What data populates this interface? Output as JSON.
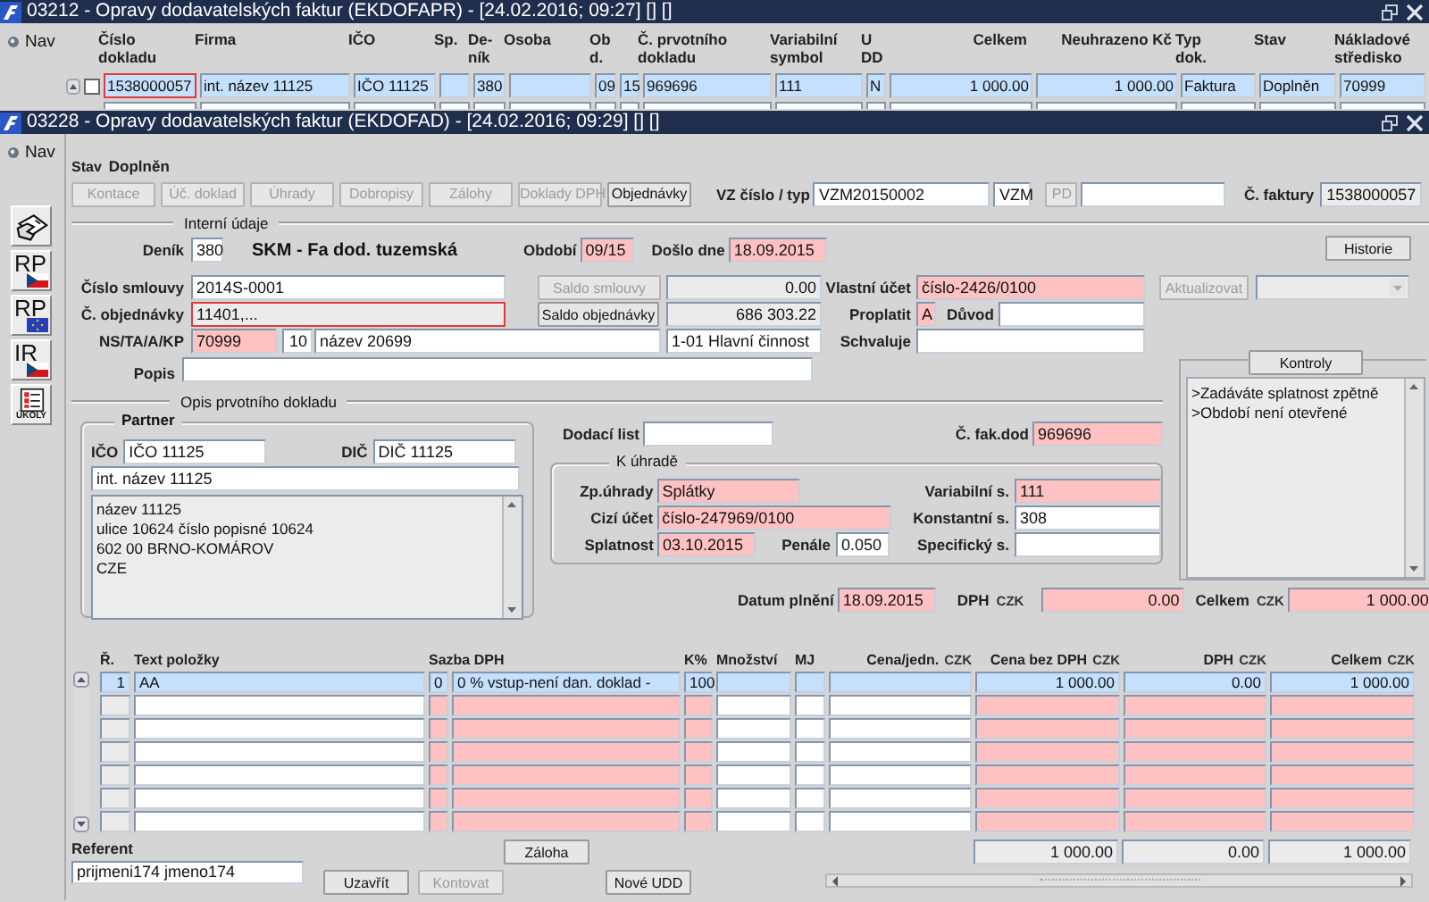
{
  "list_window": {
    "title": "03212 - Opravy dodavatelských faktur (EKDOFAPR) - [24.02.2016; 09:27] [] []",
    "nav": "Nav",
    "columns": [
      "Číslo\ndokladu",
      "Firma",
      "IČO",
      "Sp.",
      "De-\nník",
      "Osoba",
      "Ob\nd.",
      "Č. prvotního\ndokladu",
      "Variabilní\nsymbol",
      "U\nDD",
      "Celkem",
      "Neuhrazeno Kč",
      "Typ\ndok.",
      "Stav",
      "Nákladové\nstředisko"
    ],
    "rows": [
      {
        "selected": true,
        "checked": false,
        "focused": true,
        "cells": [
          "1538000057",
          "int. název 11125",
          "IČO 11125",
          "",
          "380",
          "",
          [
            "09",
            "15"
          ],
          "969696",
          "111",
          "N",
          "1 000.00",
          "1 000.00",
          "Faktura",
          "Doplněn",
          "70999"
        ]
      }
    ]
  },
  "detail_window": {
    "title": "03228 - Opravy dodavatelských faktur (EKDOFAD) - [24.02.2016; 09:29] [] []",
    "nav": "Nav",
    "side_tools": [
      {
        "kind": "hand"
      },
      {
        "kind": "czech",
        "label": "RP"
      },
      {
        "kind": "european",
        "label": "RP"
      },
      {
        "kind": "czech",
        "label": "IR"
      },
      {
        "kind": "tasks",
        "label": "ÚKOLY"
      }
    ],
    "status": {
      "label": "Stav",
      "value": "Doplněn"
    },
    "action_buttons": [
      {
        "label": "Kontace",
        "disabled": true
      },
      {
        "label": "Úč. doklad",
        "disabled": true
      },
      {
        "label": "Úhrady",
        "disabled": true
      },
      {
        "label": "Dobropisy",
        "disabled": true
      },
      {
        "label": "Zálohy",
        "disabled": true
      },
      {
        "label": "Doklady DPH",
        "disabled": true
      },
      {
        "label": "Objednávky",
        "disabled": false
      }
    ],
    "vz": {
      "label": "VZ číslo / typ",
      "number": "VZM20150002",
      "type": "VZM"
    },
    "pd_button": {
      "label": "PD",
      "disabled": true
    },
    "invoice_no": {
      "label": "Č. faktury",
      "value": "1538000057"
    },
    "internal": {
      "title": "Interní údaje",
      "denik": {
        "label": "Deník",
        "value": "380",
        "name": "SKM - Fa dod. tuzemská"
      },
      "obdobi": {
        "label": "Období",
        "value": "09/15",
        "required": true
      },
      "doslo": {
        "label": "Došlo dne",
        "value": "18.09.2015",
        "required": true
      },
      "history_button": "Historie",
      "contract": {
        "label": "Číslo smlouvy",
        "value": "2014S-0001"
      },
      "contract_balance": {
        "button": "Saldo smlouvy",
        "disabled": true,
        "value": "0.00"
      },
      "own_account": {
        "label": "Vlastní účet",
        "value": "číslo-2426/0100",
        "required": true
      },
      "update_button": {
        "label": "Aktualizovat",
        "disabled": true
      },
      "order": {
        "label": "Č. objednávky",
        "value": "11401,...",
        "focused": true
      },
      "order_balance": {
        "button": "Saldo objednávky",
        "disabled": false,
        "value": "686 303.22"
      },
      "pay": {
        "label": "Proplatit",
        "value": "A",
        "required": true
      },
      "reason": {
        "label": "Důvod"
      },
      "ns": {
        "label": "NS/TA/A/KP",
        "values": [
          "70999",
          "10",
          "název 20699",
          "1-01 Hlavní činnost"
        ]
      },
      "approves": {
        "label": "Schvaluje"
      },
      "popis": {
        "label": "Popis"
      }
    },
    "checks": {
      "button": "Kontroly",
      "messages": [
        ">Zadáváte splatnost zpětně",
        ">Období není otevřené"
      ]
    },
    "source": {
      "title": "Opis prvotního dokladu",
      "partner": {
        "title": "Partner",
        "ico_label": "IČO",
        "ico": "IČO 11125",
        "dic_label": "DIČ",
        "dic": "DIČ 11125",
        "name": "int. název 11125",
        "address": [
          "název 11125",
          "ulice 10624 číslo popisné 10624",
          "602 00 BRNO-KOMÁROV",
          "CZE"
        ]
      },
      "delivery_note": {
        "label": "Dodací list"
      },
      "supplier_invoice": {
        "label": "Č. fak.dod",
        "value": "969696",
        "required": true
      },
      "payment": {
        "title": "K úhradě",
        "method": {
          "label": "Zp.úhrady",
          "value": "Splátky",
          "required": true
        },
        "foreign_account": {
          "label": "Cizí účet",
          "value": "číslo-247969/0100",
          "required": true
        },
        "due": {
          "label": "Splatnost",
          "value": "03.10.2015",
          "required": true
        },
        "penalty": {
          "label": "Penále",
          "value": "0.050",
          "required": false
        },
        "variable": {
          "label": "Variabilní s.",
          "value": "111",
          "required": true
        },
        "constant": {
          "label": "Konstantní s.",
          "value": "308",
          "required": false
        },
        "specific": {
          "label": "Specifický s.",
          "required": false
        }
      }
    },
    "totals": {
      "date_label": "Datum plnění",
      "date": "18.09.2015",
      "vat_label": "DPH",
      "vat_currency": "CZK",
      "vat": "0.00",
      "total_label": "Celkem",
      "total_currency": "CZK",
      "total": "1 000.00"
    },
    "items": {
      "columns": [
        {
          "label": "Ř.",
          "required": false
        },
        {
          "label": "Text položky",
          "required": false
        },
        {
          "label": "Sazba DPH",
          "required": true
        },
        {
          "label": "K%",
          "required": true
        },
        {
          "label": "Množství",
          "required": false
        },
        {
          "label": "MJ",
          "required": false
        },
        {
          "label": "Cena/jedn.",
          "currency": "CZK",
          "required": false
        },
        {
          "label": "Cena bez DPH",
          "currency": "CZK",
          "required": true
        },
        {
          "label": "DPH",
          "currency": "CZK",
          "required": true
        },
        {
          "label": "Celkem",
          "currency": "CZK",
          "required": true
        }
      ],
      "rows": [
        {
          "selected": true,
          "cells": [
            "1",
            "AA",
            [
              "0",
              "0 % vstup-není dan. doklad -"
            ],
            "100",
            "",
            "",
            "",
            "1 000.00",
            "0.00",
            "1 000.00"
          ]
        }
      ],
      "sums": [
        "1 000.00",
        "0.00",
        "1 000.00"
      ]
    },
    "referent": {
      "label": "Referent",
      "value": "prijmeni174 jmeno174"
    },
    "deposit_button": {
      "label": "Záloha"
    },
    "bottom_buttons": [
      {
        "label": "Uzavřít",
        "disabled": false
      },
      {
        "label": "Kontovat",
        "disabled": true
      }
    ],
    "new_button": {
      "label": "Nové UDD"
    }
  }
}
